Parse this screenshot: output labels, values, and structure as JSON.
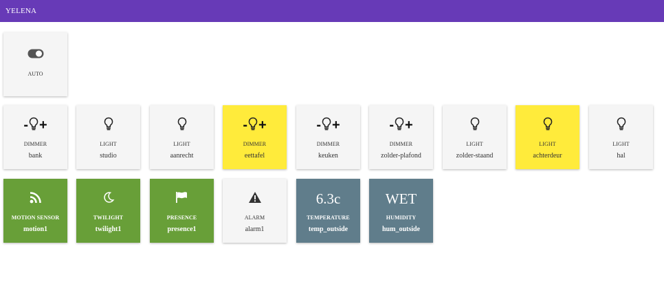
{
  "app": {
    "title": "YELENA"
  },
  "auto": {
    "label": "AUTO",
    "icon": "toggle-icon"
  },
  "row1": [
    {
      "type": "DIMMER",
      "name": "bank",
      "color": "#f5f5f5",
      "icon": "bulb-icon",
      "minus": "-",
      "plus": "+"
    },
    {
      "type": "LIGHT",
      "name": "studio",
      "color": "#f5f5f5",
      "icon": "bulb-icon"
    },
    {
      "type": "LIGHT",
      "name": "aanrecht",
      "color": "#f5f5f5",
      "icon": "bulb-icon"
    },
    {
      "type": "DIMMER",
      "name": "eettafel",
      "color": "#ffeb3b",
      "icon": "bulb-icon",
      "minus": "-",
      "plus": "+"
    },
    {
      "type": "DIMMER",
      "name": "keuken",
      "color": "#f5f5f5",
      "icon": "bulb-icon",
      "minus": "-",
      "plus": "+"
    },
    {
      "type": "DIMMER",
      "name": "zolder-plafond",
      "color": "#f5f5f5",
      "icon": "bulb-icon",
      "minus": "-",
      "plus": "+"
    },
    {
      "type": "LIGHT",
      "name": "zolder-staand",
      "color": "#f5f5f5",
      "icon": "bulb-icon"
    },
    {
      "type": "LIGHT",
      "name": "achterdeur",
      "color": "#ffeb3b",
      "icon": "bulb-icon"
    },
    {
      "type": "LIGHT",
      "name": "hal",
      "color": "#f5f5f5",
      "icon": "bulb-icon"
    }
  ],
  "row2": [
    {
      "type": "MOTION SENSOR",
      "name": "motion1",
      "icon": "rss-icon"
    },
    {
      "type": "TWILIGHT",
      "name": "twilight1",
      "icon": "moon-icon"
    },
    {
      "type": "PRESENCE",
      "name": "presence1",
      "icon": "flag-icon"
    },
    {
      "type": "ALARM",
      "name": "alarm1",
      "icon": "warning-icon"
    },
    {
      "type": "TEMPERATURE",
      "name": "temp_outside",
      "value": "6.3c"
    },
    {
      "type": "HUMIDITY",
      "name": "hum_outside",
      "value": "WET"
    }
  ],
  "colors": {
    "header": "#673ab7",
    "on": "#ffeb3b",
    "sensor": "#689f38",
    "reading": "#607d8b",
    "off": "#f5f5f5"
  }
}
